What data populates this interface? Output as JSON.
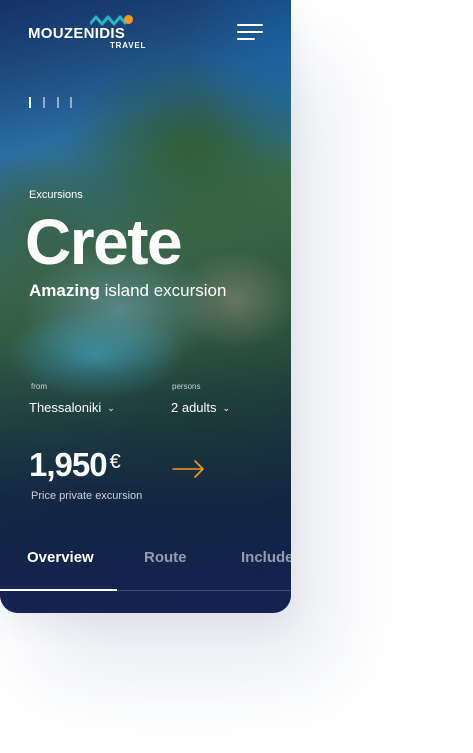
{
  "brand": {
    "name": "MOUZENIDIS",
    "sub": "TRAVEL"
  },
  "hero": {
    "category": "Excursions",
    "title": "Crete",
    "subtitle_bold": "Amazing",
    "subtitle_rest": " island excursion",
    "slide_count": 4,
    "active_slide": 1
  },
  "from": {
    "label": "from",
    "value": "Thessaloniki"
  },
  "persons": {
    "label": "persons",
    "value": "2 adults"
  },
  "price": {
    "amount": "1,950",
    "currency": "€",
    "note": "Price private excursion"
  },
  "tabs": [
    {
      "label": "Overview",
      "active": true
    },
    {
      "label": "Route",
      "active": false
    },
    {
      "label": "Included",
      "active": false
    }
  ],
  "colors": {
    "accent": "#f39a1e",
    "dark": "#14224f"
  }
}
